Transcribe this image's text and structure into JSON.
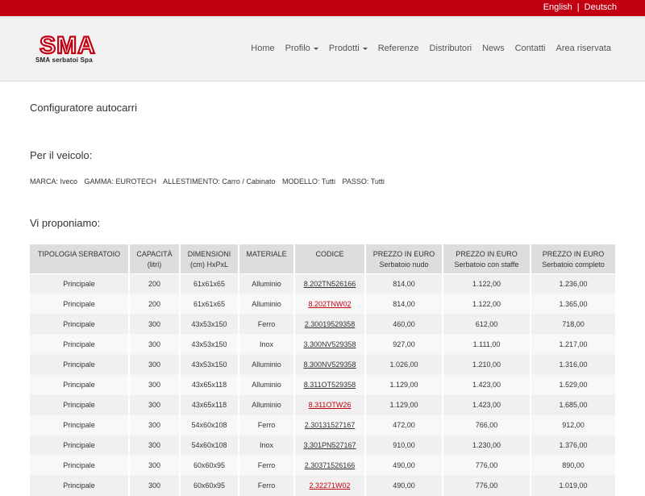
{
  "top_bar": {
    "languages": [
      "English",
      "Deutsch"
    ],
    "separator": "|"
  },
  "logo": {
    "mark": "SMA",
    "company": "SMA serbatoi Spa"
  },
  "nav": {
    "items": [
      {
        "label": "Home",
        "dropdown": false
      },
      {
        "label": "Profilo",
        "dropdown": true
      },
      {
        "label": "Prodotti",
        "dropdown": true
      },
      {
        "label": "Referenze",
        "dropdown": false
      },
      {
        "label": "Distributori",
        "dropdown": false
      },
      {
        "label": "News",
        "dropdown": false
      },
      {
        "label": "Contatti",
        "dropdown": false
      },
      {
        "label": "Area riservata",
        "dropdown": false
      }
    ]
  },
  "page": {
    "title": "Configuratore autocarri",
    "vehicle_heading": "Per il veicolo:",
    "vehicle_filters": [
      "MARCA: Iveco",
      "GAMMA: EUROTECH",
      "ALLESTIMENTO: Carro / Cabinato",
      "MODELLO: Tutti",
      "PASSO: Tutti"
    ],
    "proposal_heading": "Vi proponiamo:"
  },
  "table": {
    "headers": [
      [
        "TIPOLOGIA SERBATOIO"
      ],
      [
        "CAPACITÀ",
        "(litri)"
      ],
      [
        "DIMENSIONI",
        "(cm) HxPxL"
      ],
      [
        "MATERIALE"
      ],
      [
        "CODICE"
      ],
      [
        "PREZZO IN EURO",
        "Serbatoio nudo"
      ],
      [
        "PREZZO IN EURO",
        "Serbatoio con staffe"
      ],
      [
        "PREZZO IN EURO",
        "Serbatoio completo"
      ]
    ],
    "rows": [
      {
        "tipologia": "Principale",
        "capacita": "200",
        "dimensioni": "61x61x65",
        "materiale": "Alluminio",
        "codice": "8.202TN526166",
        "highlight": false,
        "nudo": "814,00",
        "staffe": "1.122,00",
        "completo": "1.236,00"
      },
      {
        "tipologia": "Principale",
        "capacita": "200",
        "dimensioni": "61x61x65",
        "materiale": "Alluminio",
        "codice": "8.202TNW02",
        "highlight": true,
        "nudo": "814,00",
        "staffe": "1.122,00",
        "completo": "1.365,00"
      },
      {
        "tipologia": "Principale",
        "capacita": "300",
        "dimensioni": "43x53x150",
        "materiale": "Ferro",
        "codice": "2.30019529358",
        "highlight": false,
        "nudo": "460,00",
        "staffe": "612,00",
        "completo": "718,00"
      },
      {
        "tipologia": "Principale",
        "capacita": "300",
        "dimensioni": "43x53x150",
        "materiale": "Inox",
        "codice": "3.300NV529358",
        "highlight": false,
        "nudo": "927,00",
        "staffe": "1.111,00",
        "completo": "1.217,00"
      },
      {
        "tipologia": "Principale",
        "capacita": "300",
        "dimensioni": "43x53x150",
        "materiale": "Alluminio",
        "codice": "8.300NV529358",
        "highlight": false,
        "nudo": "1.026,00",
        "staffe": "1.210,00",
        "completo": "1.316,00"
      },
      {
        "tipologia": "Principale",
        "capacita": "300",
        "dimensioni": "43x65x118",
        "materiale": "Alluminio",
        "codice": "8.311OT529358",
        "highlight": false,
        "nudo": "1.129,00",
        "staffe": "1.423,00",
        "completo": "1.529,00"
      },
      {
        "tipologia": "Principale",
        "capacita": "300",
        "dimensioni": "43x65x118",
        "materiale": "Alluminio",
        "codice": "8.311OTW26",
        "highlight": true,
        "nudo": "1.129,00",
        "staffe": "1.423,00",
        "completo": "1.685,00"
      },
      {
        "tipologia": "Principale",
        "capacita": "300",
        "dimensioni": "54x60x108",
        "materiale": "Ferro",
        "codice": "2.30131527167",
        "highlight": false,
        "nudo": "472,00",
        "staffe": "766,00",
        "completo": "912,00"
      },
      {
        "tipologia": "Principale",
        "capacita": "300",
        "dimensioni": "54x60x108",
        "materiale": "Inox",
        "codice": "3.301PN527167",
        "highlight": false,
        "nudo": "910,00",
        "staffe": "1.230,00",
        "completo": "1.376,00"
      },
      {
        "tipologia": "Principale",
        "capacita": "300",
        "dimensioni": "60x60x95",
        "materiale": "Ferro",
        "codice": "2.30371526166",
        "highlight": false,
        "nudo": "490,00",
        "staffe": "776,00",
        "completo": "890,00"
      },
      {
        "tipologia": "Principale",
        "capacita": "300",
        "dimensioni": "60x60x95",
        "materiale": "Ferro",
        "codice": "2.32271W02",
        "highlight": true,
        "nudo": "490,00",
        "staffe": "776,00",
        "completo": "1.019,00"
      }
    ]
  },
  "colors": {
    "brand_red": "#c20011",
    "header_bg": "#f2f2f2",
    "table_header_bg": "#dddddd"
  }
}
